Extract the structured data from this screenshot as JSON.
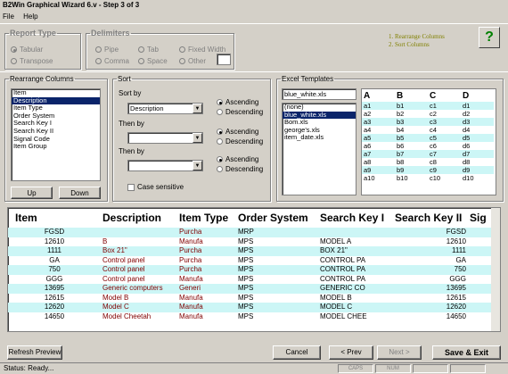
{
  "window": {
    "title": "B2Win Graphical Wizard 6.v - Step 3 of 3"
  },
  "menu": [
    "File",
    "Help"
  ],
  "report_type": {
    "legend": "Report Type",
    "options": [
      "Tabular",
      "Transpose"
    ],
    "selected": "Tabular"
  },
  "delimiters": {
    "legend": "Delimiters",
    "options": [
      "Pipe",
      "Tab",
      "Fixed Width",
      "Comma",
      "Space",
      "Other"
    ]
  },
  "steps": [
    "1. Rearrange Columns",
    "2. Sort Columns"
  ],
  "help_label": "?",
  "rearrange": {
    "legend": "Rearrange Columns",
    "items": [
      "Item",
      "Description",
      "Item Type",
      "Order System",
      "Search Key I",
      "Search Key II",
      "Signal Code",
      "Item Group"
    ],
    "selected": "Description",
    "up": "Up",
    "down": "Down"
  },
  "sort": {
    "legend": "Sort",
    "sort_by": "Sort by",
    "sort_value": "Description",
    "then_by": "Then by",
    "ascending": "Ascending",
    "descending": "Descending",
    "case_sensitive": "Case sensitive"
  },
  "excel": {
    "legend": "Excel Templates",
    "current": "blue_white.xls",
    "items": [
      "(none)",
      "blue_white.xls",
      "Bom.xls",
      "george's.xls",
      "item_date.xls"
    ],
    "selected": "blue_white.xls",
    "preview_headers": [
      "A",
      "B",
      "C",
      "D"
    ],
    "preview_rows": [
      [
        "a1",
        "b1",
        "c1",
        "d1"
      ],
      [
        "a2",
        "b2",
        "c2",
        "d2"
      ],
      [
        "a3",
        "b3",
        "c3",
        "d3"
      ],
      [
        "a4",
        "b4",
        "c4",
        "d4"
      ],
      [
        "a5",
        "b5",
        "c5",
        "d5"
      ],
      [
        "a6",
        "b6",
        "c6",
        "d6"
      ],
      [
        "a7",
        "b7",
        "c7",
        "d7"
      ],
      [
        "a8",
        "b8",
        "c8",
        "d8"
      ],
      [
        "a9",
        "b9",
        "c9",
        "d9"
      ],
      [
        "a10",
        "b10",
        "c10",
        "d10"
      ]
    ]
  },
  "data_grid": {
    "headers": [
      "Item",
      "Description",
      "Item Type",
      "Order System",
      "Search Key I",
      "Search Key II",
      "Sig"
    ],
    "rows": [
      [
        "FGSD",
        "",
        "Purcha",
        "MRP",
        "",
        "FGSD",
        ""
      ],
      [
        "12610",
        "B",
        "Manufa",
        "MPS",
        "MODEL A",
        "12610",
        ""
      ],
      [
        "1111",
        "Box 21\"",
        "Purcha",
        "MPS",
        "BOX 21\"",
        "1111",
        ""
      ],
      [
        "GA",
        "Control panel",
        "Purcha",
        "MPS",
        "CONTROL PA",
        "GA",
        ""
      ],
      [
        "750",
        "Control panel",
        "Purcha",
        "MPS",
        "CONTROL PA",
        "750",
        ""
      ],
      [
        "GGG",
        "Control panel",
        "Manufa",
        "MPS",
        "CONTROL PA",
        "GGG",
        ""
      ],
      [
        "13695",
        "Generic computers",
        "Generi",
        "MPS",
        "GENERIC CO",
        "13695",
        ""
      ],
      [
        "12615",
        "Model B",
        "Manufa",
        "MPS",
        "MODEL B",
        "12615",
        ""
      ],
      [
        "12620",
        "Model C",
        "Manufa",
        "MPS",
        "MODEL C",
        "12620",
        ""
      ],
      [
        "14650",
        "Model Cheetah",
        "Manufa",
        "MPS",
        "MODEL CHEE",
        "14650",
        ""
      ]
    ]
  },
  "buttons": {
    "refresh": "Refresh Preview",
    "cancel": "Cancel",
    "prev": "< Prev",
    "next": "Next >",
    "save": "Save & Exit"
  },
  "status": {
    "text": "Status: Ready...",
    "caps": "CAPS",
    "num": "NUM"
  },
  "colors": {
    "row_alt": "#ccf6f6",
    "selection": "#0a246a",
    "desc_text": "#800000",
    "steps_text": "#808000"
  }
}
